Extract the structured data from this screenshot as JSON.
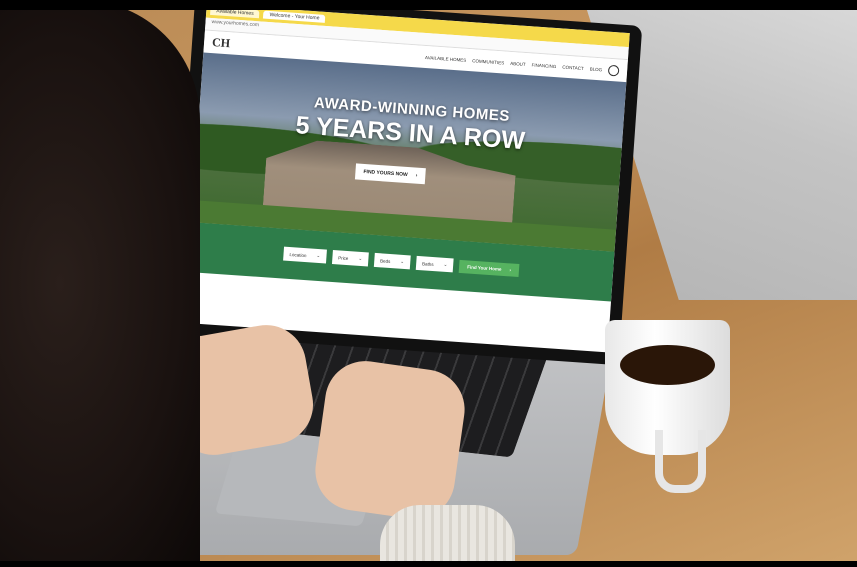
{
  "browser": {
    "tabs": [
      "Available Homes",
      "Welcome - Your Home"
    ],
    "url": "www.yourhomes.com"
  },
  "site": {
    "logo": "CH",
    "nav": [
      "AVAILABLE HOMES",
      "COMMUNITIES",
      "ABOUT",
      "FINANCING",
      "CONTACT",
      "BLOG"
    ]
  },
  "hero": {
    "title": "AWARD-WINNING HOMES",
    "subtitle": "5 YEARS IN A ROW",
    "cta": "FIND YOURS NOW",
    "cta_arrow": "›"
  },
  "search": {
    "location": "Location",
    "price": "Price",
    "beds": "Beds",
    "baths": "Baths",
    "go": "Find Your Home",
    "go_arrow": "›",
    "caret": "⌄"
  }
}
